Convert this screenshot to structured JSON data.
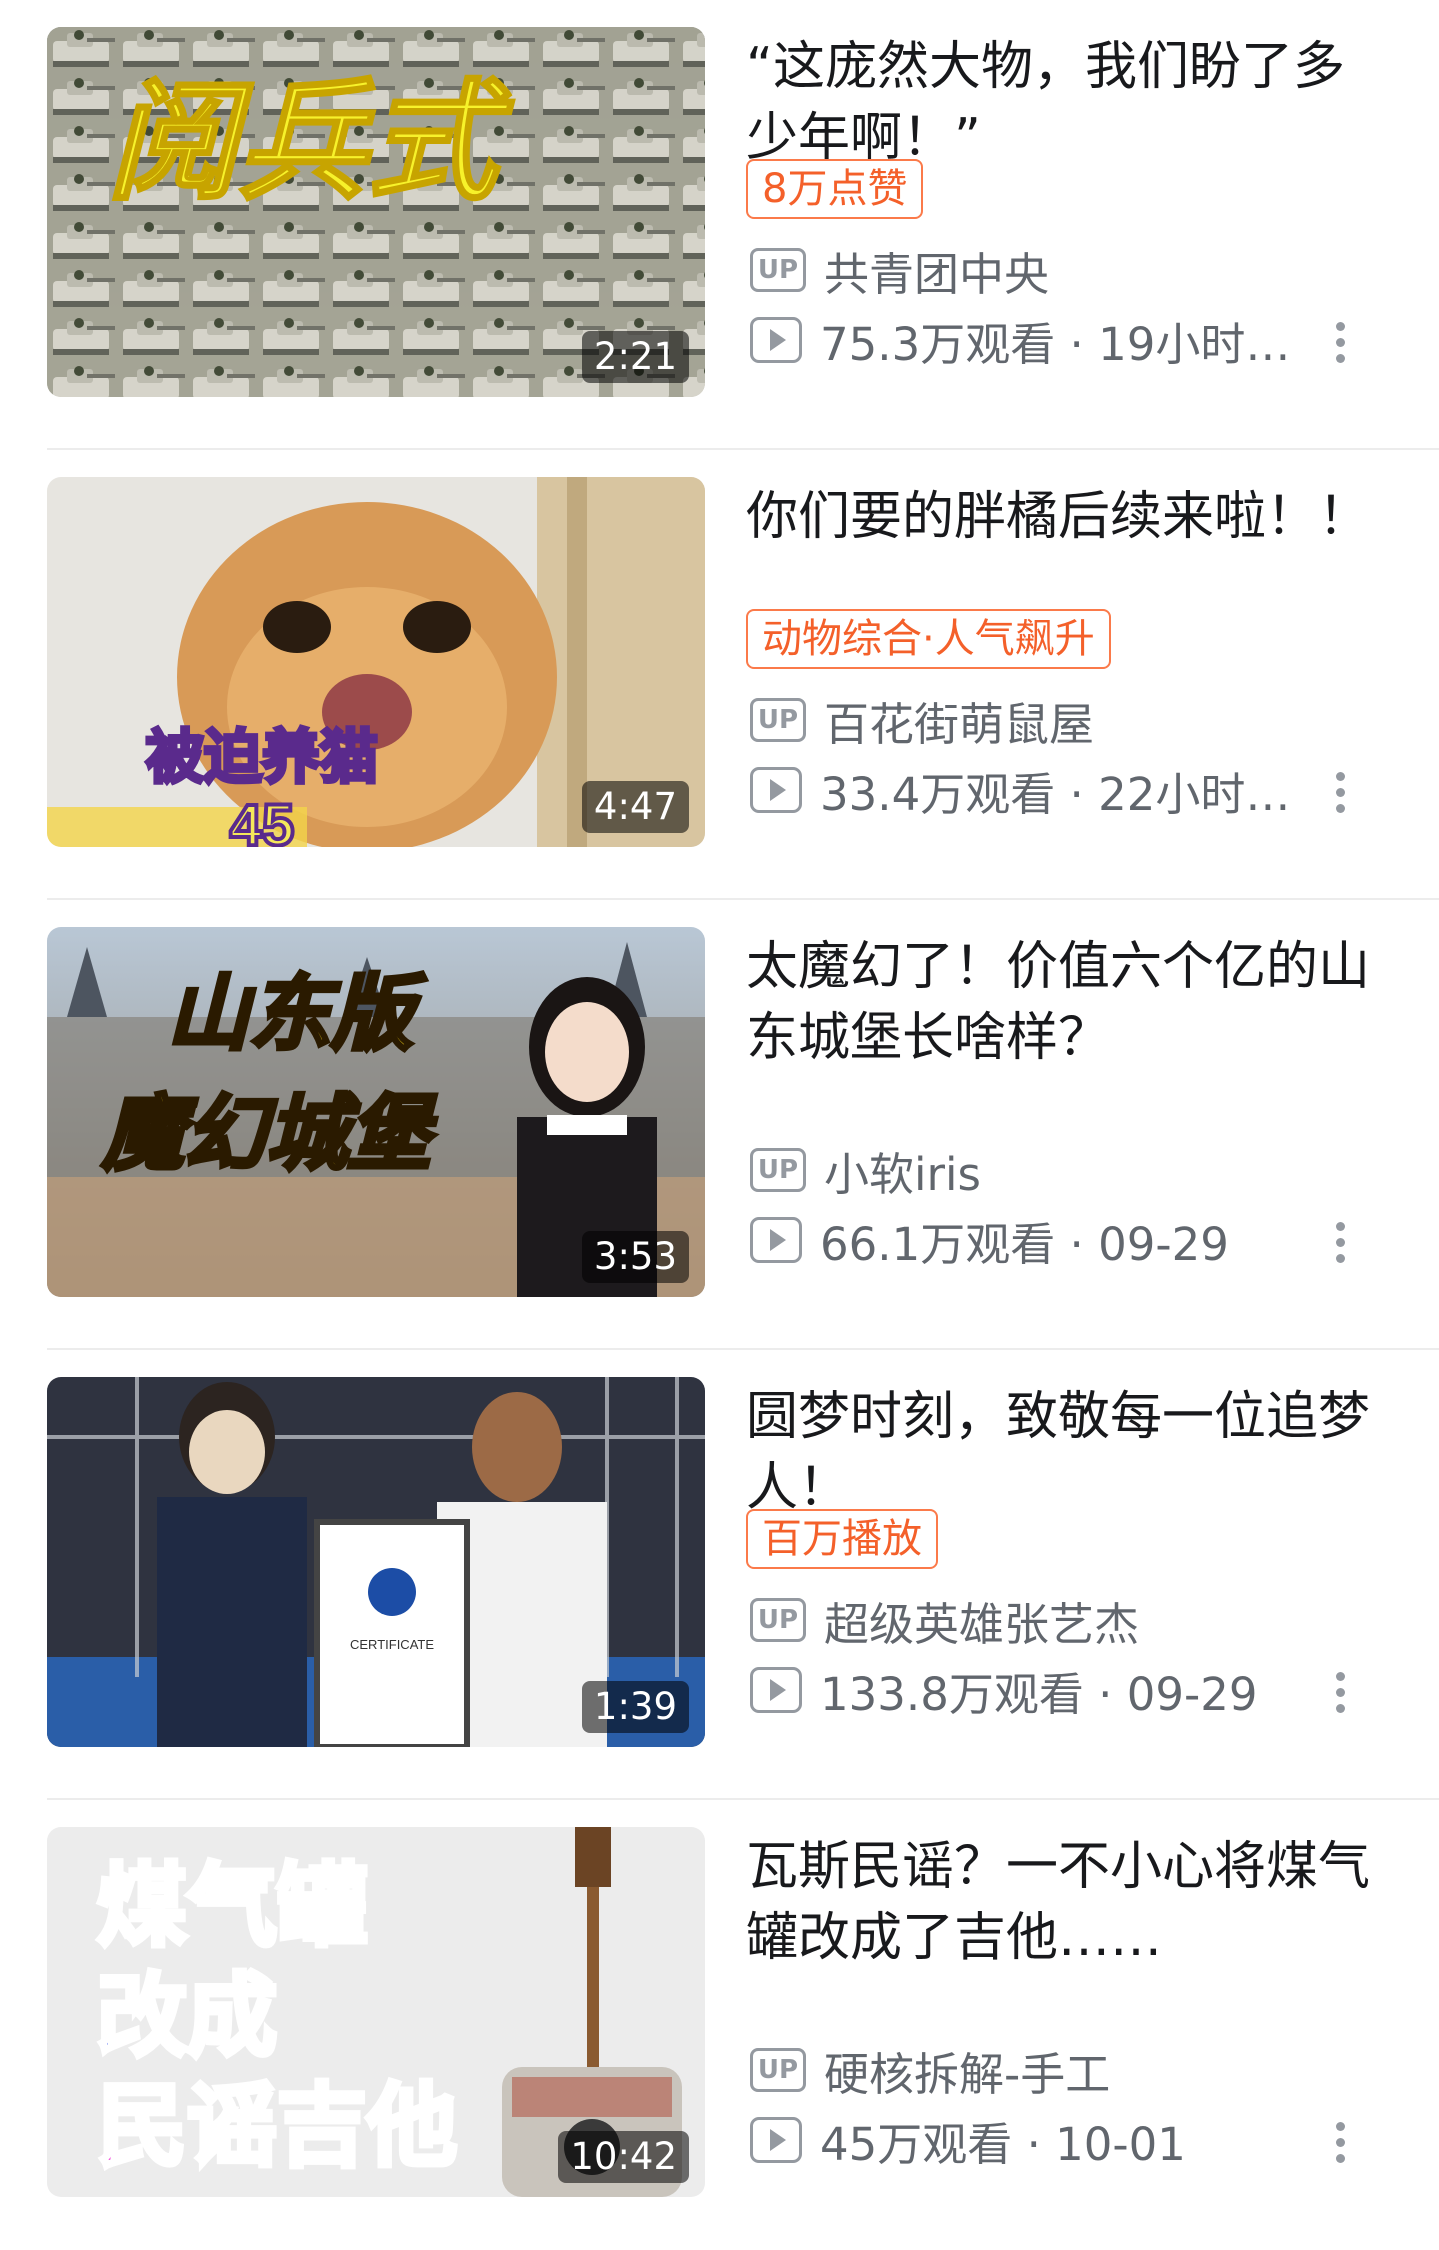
{
  "feed": {
    "items": [
      {
        "title": "“这庞然大物，我们盼了多少年啊！”",
        "tag": "8万点赞",
        "up_badge": "UP",
        "uploader": "共青团中央",
        "stats": "75.3万观看 · 19小时…",
        "duration": "2:21",
        "thumb_text": "阅兵式"
      },
      {
        "title": "你们要的胖橘后续来啦！！",
        "tag": "动物综合·人气飙升",
        "up_badge": "UP",
        "uploader": "百花街萌鼠屋",
        "stats": "33.4万观看 · 22小时…",
        "duration": "4:47",
        "thumb_text": "被迫养猫",
        "thumb_text2": "45"
      },
      {
        "title": "太魔幻了！价值六个亿的山东城堡长啥样？",
        "tag": "",
        "up_badge": "UP",
        "uploader": "小软iris",
        "stats": "66.1万观看 · 09-29",
        "duration": "3:53",
        "thumb_text": "山东版",
        "thumb_text2": "魔幻城堡"
      },
      {
        "title": "圆梦时刻，致敬每一位追梦人！",
        "tag": "百万播放",
        "up_badge": "UP",
        "uploader": "超级英雄张艺杰",
        "stats": "133.8万观看 · 09-29",
        "duration": "1:39",
        "thumb_text": "CERTIFICATE"
      },
      {
        "title": "瓦斯民谣？一不小心将煤气罐改成了吉他……",
        "tag": "",
        "up_badge": "UP",
        "uploader": "硬核拆解-手工",
        "stats": "45万观看 · 10-01",
        "duration": "10:42",
        "thumb_text": "煤气罐",
        "thumb_text2": "改成",
        "thumb_text3": "民谣吉他"
      }
    ]
  },
  "colors": {
    "tag_accent": "#f4602a",
    "secondary_text": "#61666d",
    "icon_gray": "#9499a0"
  }
}
